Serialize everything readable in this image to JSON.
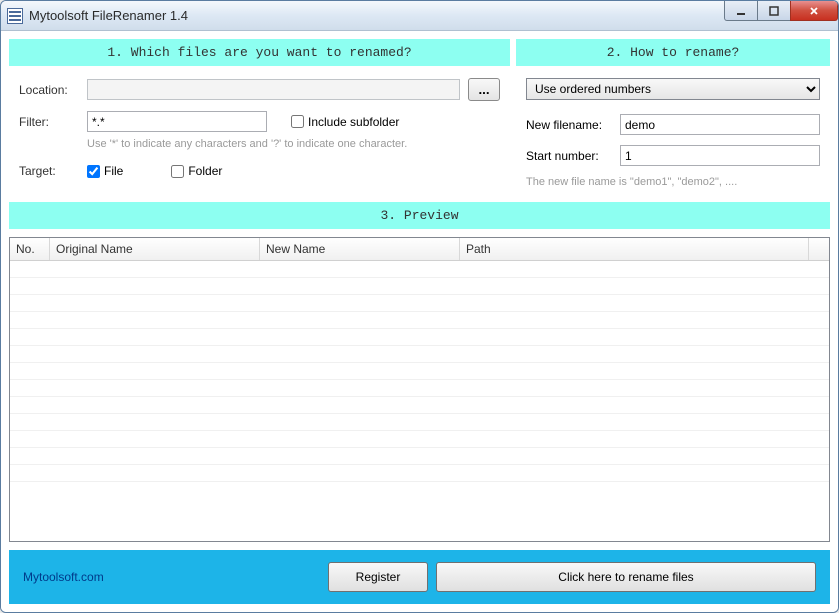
{
  "window": {
    "title": "Mytoolsoft FileRenamer 1.4"
  },
  "section1": {
    "header": "1. Which files are you want to renamed?",
    "location_label": "Location:",
    "location_value": "",
    "browse_label": "...",
    "filter_label": "Filter:",
    "filter_value": "*.*",
    "include_subfolder_label": "Include subfolder",
    "include_subfolder_checked": false,
    "hint": "Use '*' to indicate any characters and '?' to indicate one character.",
    "target_label": "Target:",
    "file_label": "File",
    "file_checked": true,
    "folder_label": "Folder",
    "folder_checked": false
  },
  "section2": {
    "header": "2. How to rename?",
    "method_selected": "Use ordered numbers",
    "new_filename_label": "New filename:",
    "new_filename_value": "demo",
    "start_number_label": "Start number:",
    "start_number_value": "1",
    "hint": "The new file name is \"demo1\", \"demo2\", ...."
  },
  "preview": {
    "header": "3. Preview",
    "columns": {
      "no": "No.",
      "original": "Original Name",
      "new": "New Name",
      "path": "Path"
    }
  },
  "footer": {
    "link": "Mytoolsoft.com",
    "register": "Register",
    "rename": "Click here to rename files"
  }
}
